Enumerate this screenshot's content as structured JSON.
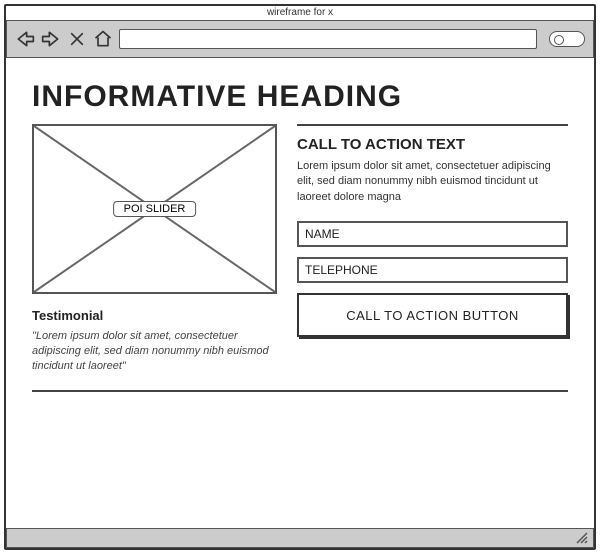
{
  "browser": {
    "title": "wireframe for x"
  },
  "content": {
    "heading": "INFORMATIVE HEADING",
    "slider_label": "POI SLIDER",
    "testimonial": {
      "title": "Testimonial",
      "body": "\"Lorem ipsum dolor sit amet, consectetuer adipiscing elit, sed diam nonummy nibh euismod tincidunt ut laoreet\""
    },
    "cta": {
      "heading": "CALL TO ACTION TEXT",
      "body": "Lorem ipsum dolor sit amet, consectetuer adipiscing elit, sed diam nonummy nibh euismod tincidunt ut laoreet dolore magna",
      "name_placeholder": "NAME",
      "telephone_placeholder": "TELEPHONE",
      "button_label": "CALL TO ACTION BUTTON"
    }
  }
}
